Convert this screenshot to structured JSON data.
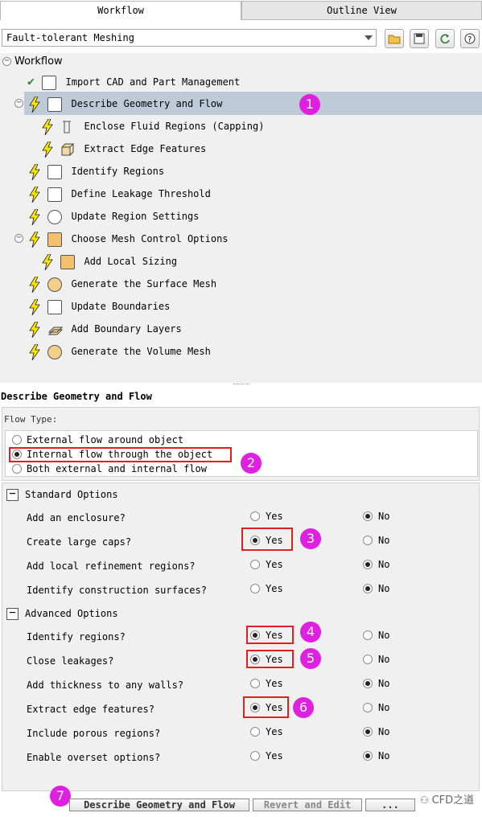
{
  "tabs": {
    "workflow": "Workflow",
    "outline": "Outline View"
  },
  "workflow_select": {
    "value": "Fault-tolerant Meshing"
  },
  "tree": {
    "root": "Workflow",
    "items": [
      {
        "label": "Import CAD and Part Management",
        "status": "done",
        "icon": "cad-icon"
      },
      {
        "label": "Describe Geometry and Flow",
        "status": "pending",
        "icon": "geometry-icon",
        "selected": true
      },
      {
        "label": "Enclose Fluid Regions (Capping)",
        "status": "pending",
        "icon": "capping-icon"
      },
      {
        "label": "Extract Edge Features",
        "status": "pending",
        "icon": "edge-features-icon"
      },
      {
        "label": "Identify Regions",
        "status": "pending",
        "icon": "regions-icon"
      },
      {
        "label": "Define Leakage Threshold",
        "status": "pending",
        "icon": "leakage-icon"
      },
      {
        "label": "Update Region Settings",
        "status": "pending",
        "icon": "region-settings-icon"
      },
      {
        "label": "Choose Mesh Control Options",
        "status": "pending",
        "icon": "mesh-control-icon"
      },
      {
        "label": "Add Local Sizing",
        "status": "pending",
        "icon": "local-sizing-icon"
      },
      {
        "label": "Generate the Surface Mesh",
        "status": "pending",
        "icon": "surface-mesh-icon"
      },
      {
        "label": "Update Boundaries",
        "status": "pending",
        "icon": "boundaries-icon"
      },
      {
        "label": "Add Boundary Layers",
        "status": "pending",
        "icon": "boundary-layers-icon"
      },
      {
        "label": "Generate the Volume Mesh",
        "status": "pending",
        "icon": "volume-mesh-icon"
      }
    ]
  },
  "panel": {
    "title": "Describe Geometry and Flow",
    "flow_type_label": "Flow Type:",
    "flow_options": [
      "External flow around object",
      "Internal flow through the object",
      "Both external and internal flow"
    ],
    "flow_selected": "Internal flow through the object",
    "standard_title": "Standard Options",
    "standard": [
      {
        "q": "Add an enclosure?",
        "value": "No"
      },
      {
        "q": "Create large caps?",
        "value": "Yes"
      },
      {
        "q": "Add local refinement regions?",
        "value": "No"
      },
      {
        "q": "Identify construction surfaces?",
        "value": "No"
      }
    ],
    "advanced_title": "Advanced Options",
    "advanced": [
      {
        "q": "Identify regions?",
        "value": "Yes"
      },
      {
        "q": "Close leakages?",
        "value": "Yes"
      },
      {
        "q": "Add thickness to any walls?",
        "value": "No"
      },
      {
        "q": "Extract edge features?",
        "value": "Yes"
      },
      {
        "q": "Include porous regions?",
        "value": "No"
      },
      {
        "q": "Enable overset options?",
        "value": "No"
      }
    ],
    "yes": "Yes",
    "no": "No"
  },
  "buttons": {
    "describe": "Describe Geometry and Flow",
    "revert": "Revert and Edit",
    "more": "..."
  },
  "markers": [
    "1",
    "2",
    "3",
    "4",
    "5",
    "6",
    "7"
  ],
  "watermark": "CFD之道",
  "colors": {
    "selection": "#bfcad9",
    "marker": "#e020e0",
    "highlight": "#e02020"
  }
}
